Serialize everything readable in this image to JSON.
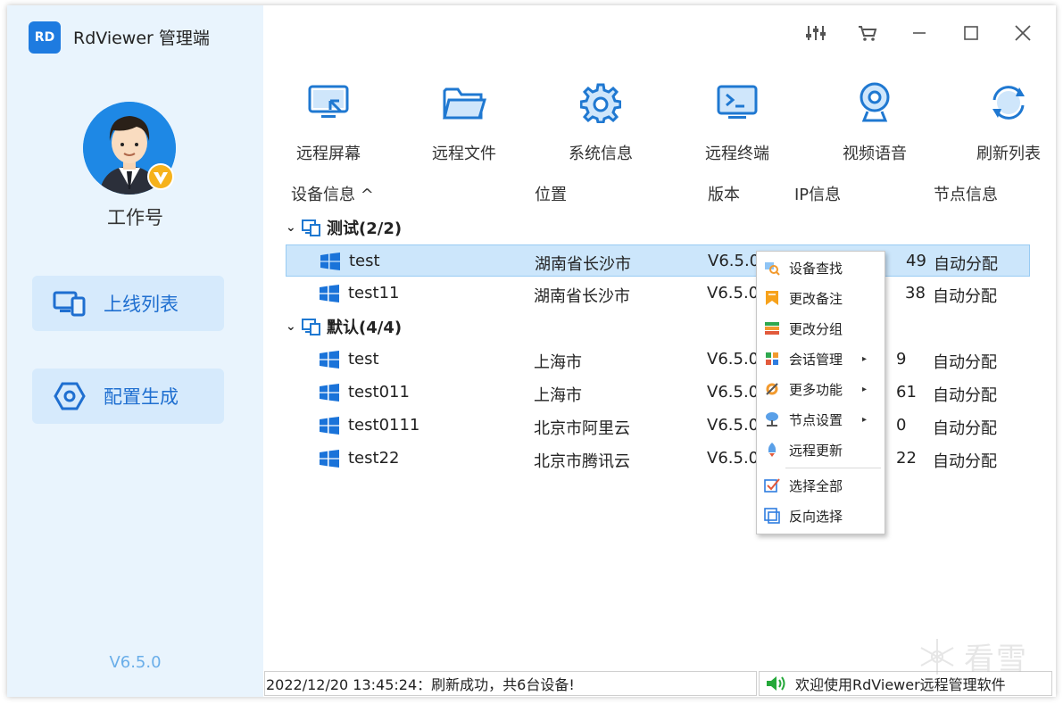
{
  "app": {
    "logo": "RD",
    "title": "RdViewer  管理端",
    "version": "V6.5.0"
  },
  "user": {
    "name": "工作号"
  },
  "sidebar": {
    "items": [
      {
        "label": "上线列表",
        "icon": "devices-icon"
      },
      {
        "label": "配置生成",
        "icon": "hexagon-settings-icon"
      }
    ]
  },
  "toolbar": {
    "items": [
      {
        "label": "远程屏幕",
        "icon": "remote-screen-icon"
      },
      {
        "label": "远程文件",
        "icon": "folder-icon"
      },
      {
        "label": "系统信息",
        "icon": "gear-icon"
      },
      {
        "label": "远程终端",
        "icon": "terminal-icon"
      },
      {
        "label": "视频语音",
        "icon": "webcam-icon"
      },
      {
        "label": "刷新列表",
        "icon": "refresh-icon"
      }
    ]
  },
  "table": {
    "headers": {
      "device": "设备信息 ^",
      "location": "位置",
      "version": "版本",
      "ip": "IP信息",
      "node": "节点信息"
    },
    "groups": [
      {
        "title": "测试(2/2)",
        "rows": [
          {
            "name": "test",
            "location": "湖南省长沙市",
            "version": "V6.5.0",
            "ip_tail": "49",
            "node": "自动分配",
            "selected": true
          },
          {
            "name": "test11",
            "location": "湖南省长沙市",
            "version": "V6.5.0",
            "ip_tail": "38",
            "node": "自动分配"
          }
        ]
      },
      {
        "title": "默认(4/4)",
        "rows": [
          {
            "name": "test",
            "location": "上海市",
            "version": "V6.5.0",
            "ip_tail": "9",
            "node": "自动分配"
          },
          {
            "name": "test011",
            "location": "上海市",
            "version": "V6.5.0",
            "ip_tail": "61",
            "node": "自动分配"
          },
          {
            "name": "test0111",
            "location": "北京市阿里云",
            "version": "V6.5.0",
            "ip_tail": "0",
            "node": "自动分配"
          },
          {
            "name": "test22",
            "location": "北京市腾讯云",
            "version": "V6.5.0",
            "ip_tail": "22",
            "node": "自动分配"
          }
        ]
      }
    ]
  },
  "context_menu": {
    "items": [
      {
        "label": "设备查找",
        "icon": "search-device-icon"
      },
      {
        "label": "更改备注",
        "icon": "bookmark-icon"
      },
      {
        "label": "更改分组",
        "icon": "group-icon"
      },
      {
        "label": "会话管理",
        "icon": "session-icon",
        "submenu": true
      },
      {
        "label": "更多功能",
        "icon": "tools-icon",
        "submenu": true
      },
      {
        "label": "节点设置",
        "icon": "node-icon",
        "submenu": true
      },
      {
        "label": "远程更新",
        "icon": "rocket-icon"
      },
      {
        "label": "选择全部",
        "icon": "check-all-icon"
      },
      {
        "label": "反向选择",
        "icon": "invert-select-icon"
      }
    ]
  },
  "status": {
    "left": "2022/12/20 13:45:24：刷新成功，共6台设备!",
    "right": "欢迎使用RdViewer远程管理软件"
  },
  "watermark": {
    "text": "看雪"
  },
  "colors": {
    "accent": "#1e7be0",
    "sidebar_bg": "#e9f4fd",
    "selected_row": "#cce6fb"
  }
}
